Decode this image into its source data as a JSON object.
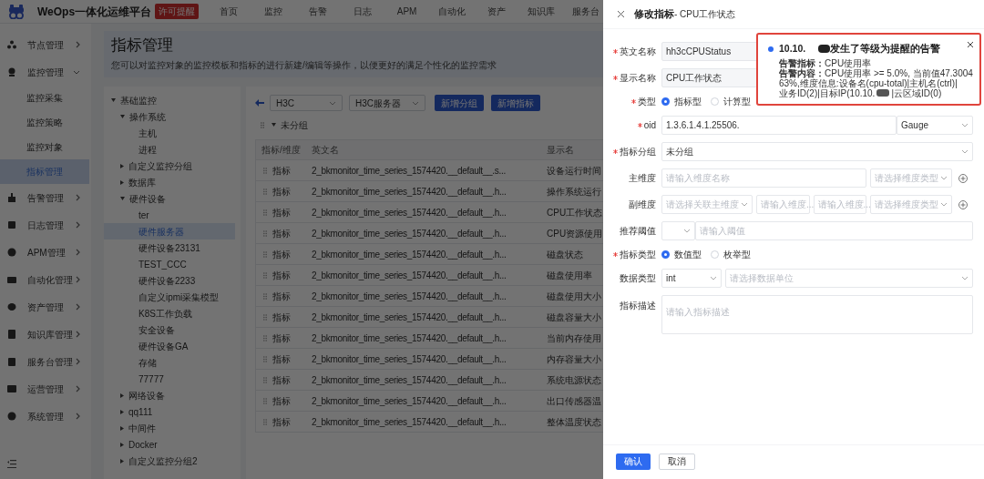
{
  "topbar": {
    "title": "WeOps一体化运维平台",
    "badge": "许可提醒",
    "nav": [
      {
        "label": "首页"
      },
      {
        "label": "监控"
      },
      {
        "label": "告警"
      },
      {
        "label": "日志"
      },
      {
        "label": "APM"
      },
      {
        "label": "自动化"
      },
      {
        "label": "资产"
      },
      {
        "label": "知识库"
      },
      {
        "label": "服务台"
      }
    ]
  },
  "sidebar": {
    "items": [
      {
        "label": "节点管理",
        "expanded": false,
        "selected": false
      },
      {
        "label": "监控管理",
        "expanded": true,
        "selected": false,
        "children": [
          {
            "label": "监控采集",
            "selected": false
          },
          {
            "label": "监控策略",
            "selected": false
          },
          {
            "label": "监控对象",
            "selected": false
          },
          {
            "label": "指标管理",
            "selected": true
          }
        ]
      },
      {
        "label": "告警管理",
        "expanded": false,
        "selected": false
      },
      {
        "label": "日志管理",
        "expanded": false,
        "selected": false
      },
      {
        "label": "APM管理",
        "expanded": false,
        "selected": false
      },
      {
        "label": "自动化管理",
        "expanded": false,
        "selected": false
      },
      {
        "label": "资产管理",
        "expanded": false,
        "selected": false
      },
      {
        "label": "知识库管理",
        "expanded": false,
        "selected": false
      },
      {
        "label": "服务台管理",
        "expanded": false,
        "selected": false
      },
      {
        "label": "运营管理",
        "expanded": false,
        "selected": false
      },
      {
        "label": "系统管理",
        "expanded": false,
        "selected": false
      }
    ]
  },
  "header": {
    "title": "指标管理",
    "subtitle": "您可以对监控对象的监控模板和指标的进行新建/编辑等操作，以便更好的满足个性化的监控需求"
  },
  "tree": [
    {
      "label": "基础监控",
      "expanded": true,
      "selected": false,
      "children": [
        {
          "label": "操作系统",
          "expanded": true,
          "selected": false,
          "children": [
            {
              "label": "主机",
              "selected": false
            },
            {
              "label": "进程",
              "selected": false
            }
          ]
        },
        {
          "label": "自定义监控分组",
          "expanded": false,
          "selected": false
        },
        {
          "label": "数据库",
          "expanded": false,
          "selected": false
        },
        {
          "label": "硬件设备",
          "expanded": true,
          "selected": false,
          "children": [
            {
              "label": "ter",
              "selected": false
            },
            {
              "label": "硬件服务器",
              "selected": true
            },
            {
              "label": "硬件设备23131",
              "selected": false
            },
            {
              "label": "TEST_CCC",
              "selected": false
            },
            {
              "label": "硬件设备2233",
              "selected": false
            },
            {
              "label": "自定义ipmi采集模型",
              "selected": false
            },
            {
              "label": "K8S工作负载",
              "selected": false
            },
            {
              "label": "安全设备",
              "selected": false
            },
            {
              "label": "硬件设备GA",
              "selected": false
            },
            {
              "label": "存储",
              "selected": false
            },
            {
              "label": "77777",
              "selected": false
            }
          ]
        },
        {
          "label": "网络设备",
          "expanded": false,
          "selected": false
        },
        {
          "label": "qq111",
          "expanded": false,
          "selected": false
        },
        {
          "label": "中间件",
          "expanded": false,
          "selected": false
        },
        {
          "label": "Docker",
          "expanded": false,
          "selected": false
        },
        {
          "label": "自定义监控分组2",
          "expanded": false,
          "selected": false
        }
      ]
    }
  ],
  "toolbar": {
    "selects": [
      "H3C",
      "H3C服务器"
    ],
    "buttons": [
      "新增分组",
      "新增指标"
    ]
  },
  "group": {
    "label": "未分组",
    "expanded": true
  },
  "table": {
    "columns": [
      "指标/维度",
      "英文名",
      "显示名"
    ],
    "rows": [
      [
        "指标",
        "2_bkmonitor_time_series_1574420.__default__.s...",
        "设备运行时间"
      ],
      [
        "指标",
        "2_bkmonitor_time_series_1574420.__default__.h...",
        "操作系统运行"
      ],
      [
        "指标",
        "2_bkmonitor_time_series_1574420.__default__.h...",
        "CPU工作状态"
      ],
      [
        "指标",
        "2_bkmonitor_time_series_1574420.__default__.h...",
        "CPU资源使用"
      ],
      [
        "指标",
        "2_bkmonitor_time_series_1574420.__default__.h...",
        "磁盘状态"
      ],
      [
        "指标",
        "2_bkmonitor_time_series_1574420.__default__.h...",
        "磁盘使用率"
      ],
      [
        "指标",
        "2_bkmonitor_time_series_1574420.__default__.h...",
        "磁盘使用大小"
      ],
      [
        "指标",
        "2_bkmonitor_time_series_1574420.__default__.h...",
        "磁盘容量大小"
      ],
      [
        "指标",
        "2_bkmonitor_time_series_1574420.__default__.h...",
        "当前内存使用"
      ],
      [
        "指标",
        "2_bkmonitor_time_series_1574420.__default__.h...",
        "内存容量大小"
      ],
      [
        "指标",
        "2_bkmonitor_time_series_1574420.__default__.h...",
        "系统电源状态"
      ],
      [
        "指标",
        "2_bkmonitor_time_series_1574420.__default__.h...",
        "出口传感器温"
      ],
      [
        "指标",
        "2_bkmonitor_time_series_1574420.__default__.h...",
        "整体温度状态"
      ]
    ]
  },
  "drawer": {
    "title": "修改指标",
    "subtitle": "- CPU工作状态",
    "form": [
      {
        "kind": "input",
        "label": "英文名称",
        "required": true,
        "value": "hh3cCPUStatus"
      },
      {
        "kind": "input",
        "label": "显示名称",
        "required": true,
        "value": "CPU工作状态"
      },
      {
        "kind": "radio",
        "label": "类型",
        "required": true,
        "options": [
          {
            "label": "指标型",
            "selected": true
          },
          {
            "label": "计算型",
            "selected": false
          }
        ]
      },
      {
        "kind": "oid",
        "label": "oid",
        "required": true,
        "value": "1.3.6.1.4.1.25506.",
        "select": "Gauge"
      },
      {
        "kind": "select",
        "label": "指标分组",
        "required": true,
        "value": "未分组"
      },
      {
        "kind": "dimension",
        "label": "主维度",
        "required": false,
        "placeholders": [
          "请输入维度名称",
          "请选择维度类型"
        ]
      },
      {
        "kind": "sub_dimension",
        "label": "副维度",
        "required": false,
        "placeholders": [
          "请选择关联主维度",
          "请输入维度...",
          "请输入维度...",
          "请选择维度类型"
        ]
      },
      {
        "kind": "threshold",
        "label": "推荐阈值",
        "required": false,
        "placeholder": "请输入阈值"
      },
      {
        "kind": "radio",
        "label": "指标类型",
        "required": true,
        "options": [
          {
            "label": "数值型",
            "selected": true
          },
          {
            "label": "枚举型",
            "selected": false
          }
        ]
      },
      {
        "kind": "data_type",
        "label": "数据类型",
        "required": false,
        "value": "int",
        "placeholder": "请选择数据单位"
      },
      {
        "kind": "textarea",
        "label": "指标描述",
        "required": false,
        "placeholder": "请输入指标描述"
      }
    ],
    "buttons": [
      {
        "label": "确认",
        "kind": "primary"
      },
      {
        "label": "取消",
        "kind": "default"
      }
    ]
  },
  "notification": {
    "ip": "10.10.",
    "title": "发生了等级为提醒的告警",
    "lines": [
      "**告警指标：**CPU使用率",
      "**告警内容：**CPU使用率 >= 5.0%, 当前值47.300463%,维度信息:设备名(cpu-total)|主机名(ctrl)|"
    ],
    "last_before": "业务ID(2)|目标IP(10.10.",
    "last_after": "|云区域ID(0)"
  }
}
